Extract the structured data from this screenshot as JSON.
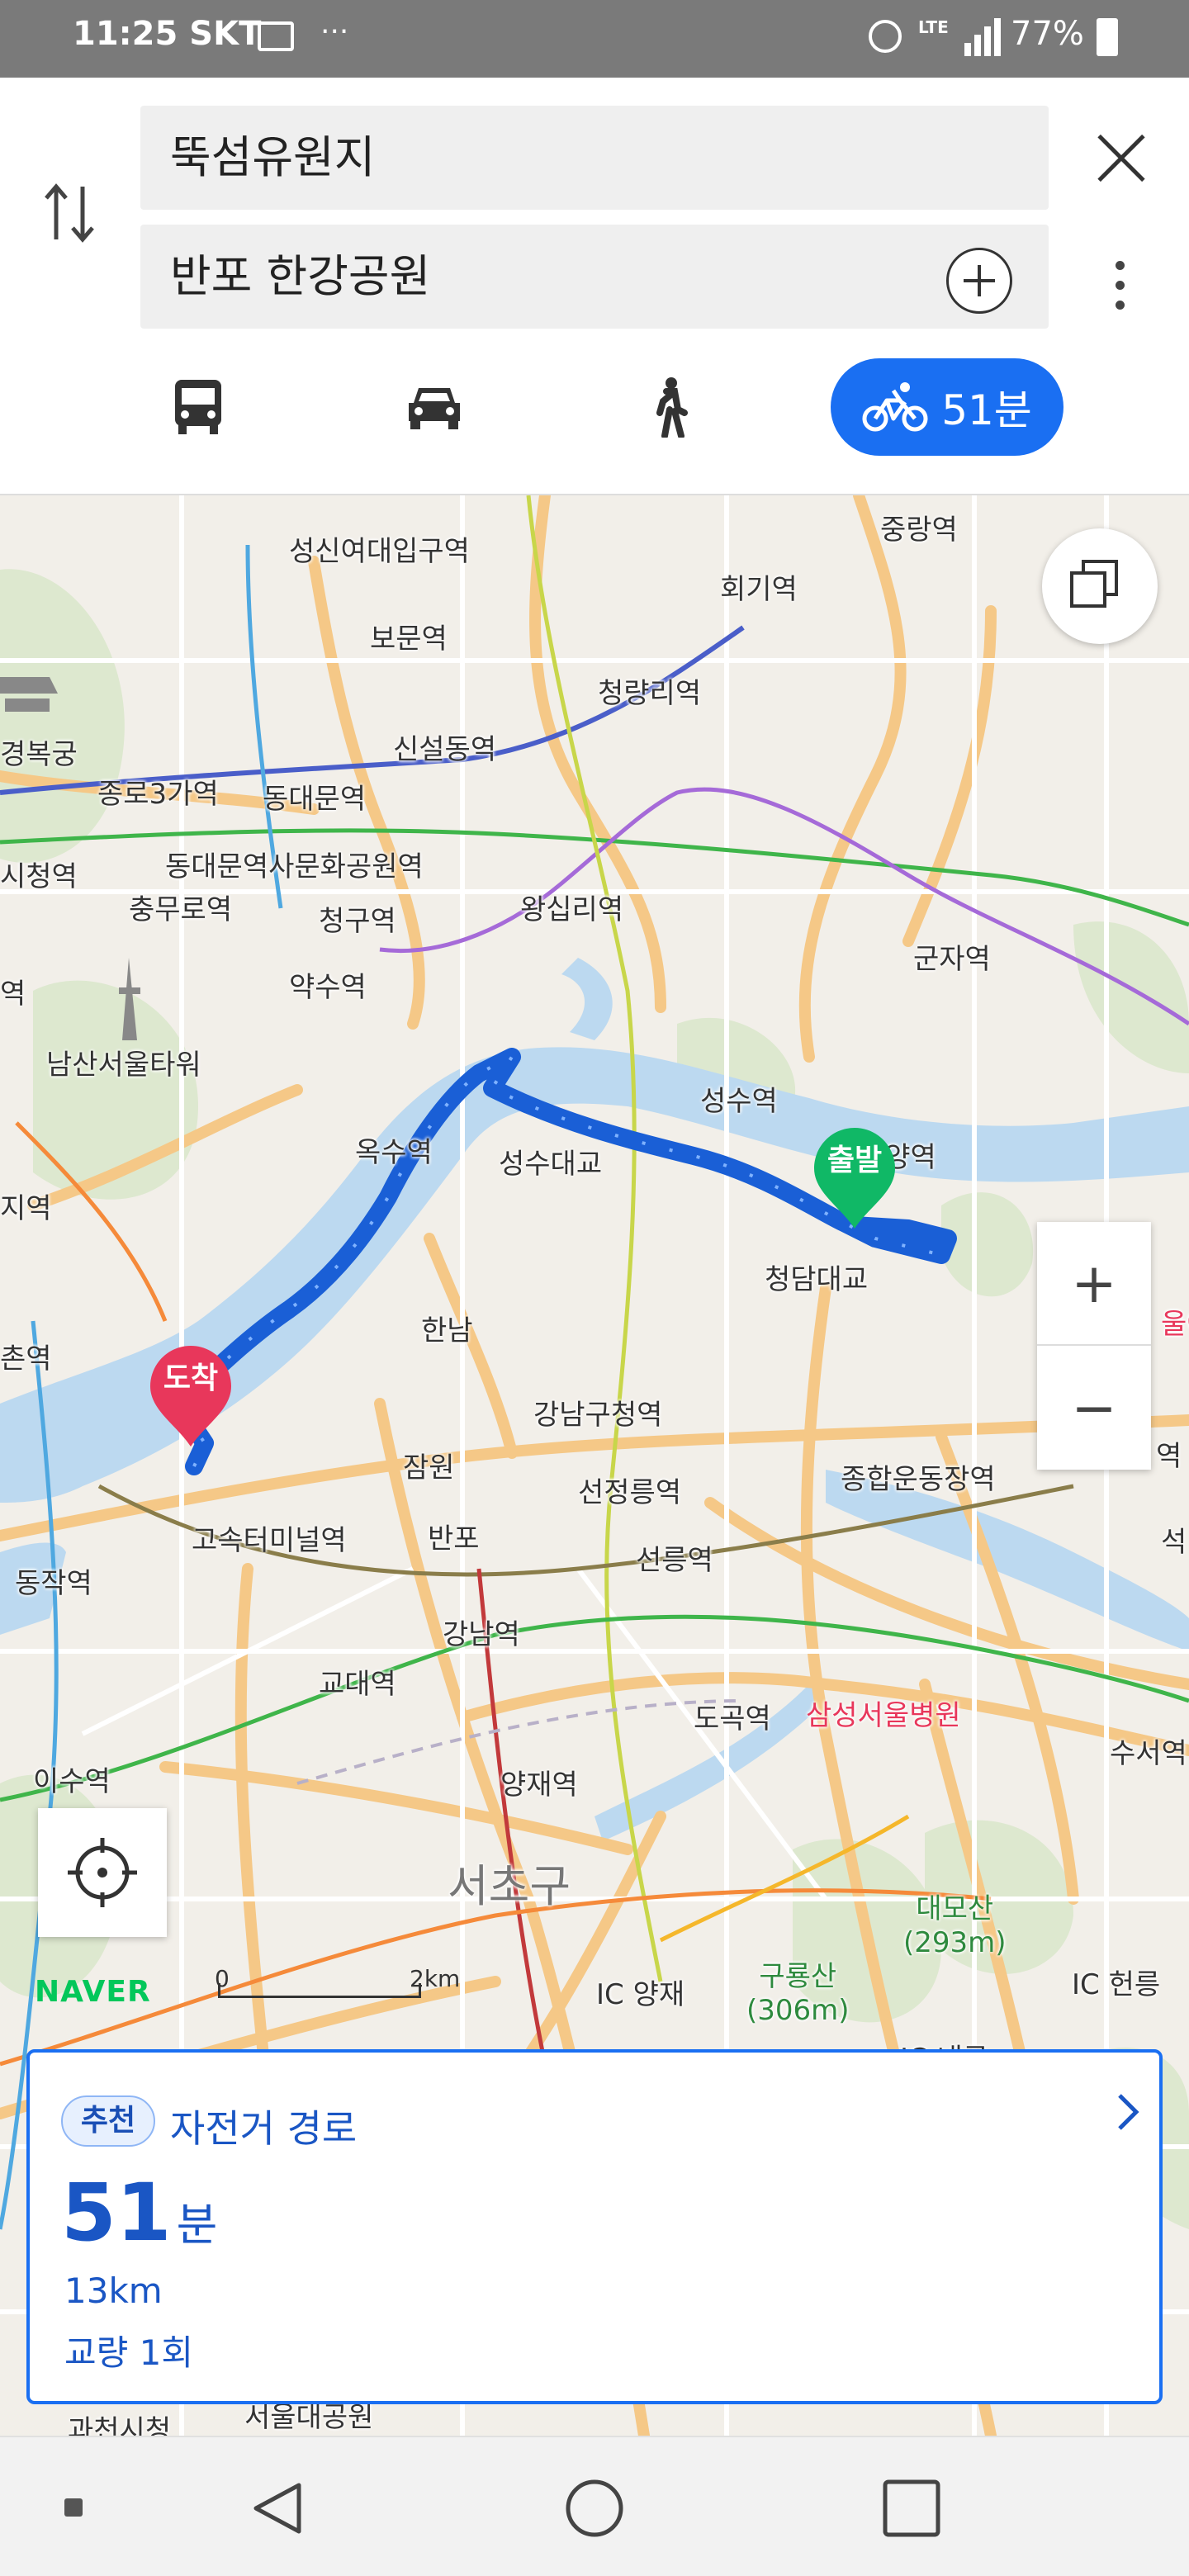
{
  "status_bar": {
    "time": "11:25",
    "carrier": "SKT",
    "overflow": "···",
    "network": "LTE",
    "battery": "77%"
  },
  "search": {
    "origin": "뚝섬유원지",
    "destination": "반포 한강공원"
  },
  "modes": {
    "icons": [
      "bus-icon",
      "car-icon",
      "walk-icon",
      "bike-icon"
    ],
    "bike_time": "51분",
    "active": "bike"
  },
  "map": {
    "start_pin": "출발",
    "end_pin": "도착",
    "labels": {
      "seongsin": "성신여대입구역",
      "junghwa": "중랑역",
      "hoegi": "회기역",
      "bomun": "보문역",
      "cheongnyangni": "청량리역",
      "gyeongbokgung": "경복궁",
      "sinseol": "신설동역",
      "jongno3": "종로3가역",
      "dongdaemun": "동대문역",
      "cityhall": "시청역",
      "ddp": "동대문역사문화공원역",
      "chungmuro": "충무로역",
      "wangsimni": "왕십리역",
      "cheonggu": "청구역",
      "gunja": "군자역",
      "yaksu": "약수역",
      "yeok": "역",
      "namsan": "남산서울타워",
      "seongsu": "성수역",
      "oksu": "옥수역",
      "seongsu_bridge": "성수대교",
      "jayang": "자양역",
      "ji": "지역",
      "cheongdam_bridge": "청담대교",
      "hannam": "한남",
      "chon": "촌역",
      "ul": "울어",
      "gangnamgu": "강남구청역",
      "jamwon": "잠원",
      "seonjeongneung": "선정릉역",
      "sports": "종합운동장역",
      "yeok2": "역",
      "express": "고속터미널역",
      "banpo": "반포",
      "seolleung": "선릉역",
      "seok": "석",
      "dongjak": "동작역",
      "gangnam": "강남역",
      "gyodae": "교대역",
      "dogok": "도곡역",
      "samsung": "삼성서울병원",
      "suseo": "수서역",
      "isu": "이수역",
      "yangjae": "양재역",
      "seocho": "서초구",
      "daemosan": "대모산",
      "daemosan_h": "(293m)",
      "guryongsan": "구룡산",
      "guryongsan_h": "(306m)",
      "yangjae_ic": "양재",
      "heolleung": "헌릉",
      "naegok": "내곡",
      "ic": "IC",
      "gwacheon": "과천시청",
      "seoulpark": "서울대공원"
    },
    "logo": "NAVER",
    "scale_zero": "0",
    "scale_dist": "2km"
  },
  "route": {
    "badge": "추천",
    "type": "자전거 경로",
    "duration_value": "51",
    "duration_unit": "분",
    "distance": "13km",
    "bridges": "교량 1회"
  },
  "colors": {
    "accent": "#1a6ff2",
    "route": "#1a5fd6",
    "start_pin": "#10b866",
    "end_pin": "#e8375b",
    "river": "#bcd9f0"
  }
}
